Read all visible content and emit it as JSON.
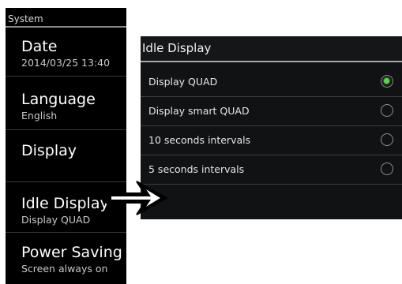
{
  "settings_panel": {
    "header": "System",
    "items": [
      {
        "title": "Date",
        "subtitle": "2014/03/25 13:40"
      },
      {
        "title": "Language",
        "subtitle": "English"
      },
      {
        "title": "Display",
        "subtitle": ""
      },
      {
        "title": "Idle Display",
        "subtitle": "Display QUAD"
      },
      {
        "title": "Power Saving",
        "subtitle": "Screen always on"
      }
    ]
  },
  "idle_dialog": {
    "title": "Idle Display",
    "options": [
      {
        "label": "Display QUAD",
        "selected": true
      },
      {
        "label": "Display smart QUAD",
        "selected": false
      },
      {
        "label": "10 seconds intervals",
        "selected": false
      },
      {
        "label": "5 seconds intervals",
        "selected": false
      }
    ]
  },
  "colors": {
    "selected_radio": "#5ad64a",
    "panel_bg": "#000000"
  },
  "icons": {
    "pointer": "right-arrow-icon"
  }
}
